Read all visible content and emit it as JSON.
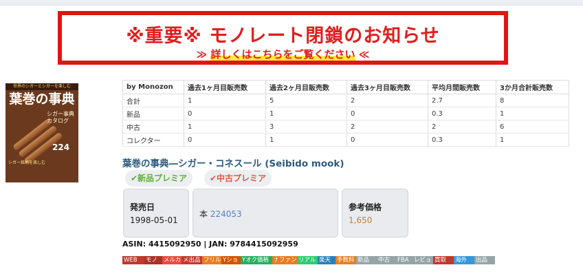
{
  "banner": {
    "title": "※重要※ モノレート閉鎖のお知らせ",
    "link_prefix": "≫ ",
    "link_text": "詳しくはこちらをご覧ください",
    "link_suffix": " ≪"
  },
  "cover": {
    "top_text": "世界のシガーとシガーを楽しむ",
    "title": "葉巻の事典",
    "sub_text": "シガー事典カタログ",
    "number": "224",
    "bottom_text": "シガー銘柄を楽しむ"
  },
  "sales_table": {
    "headers": [
      "by Monozon",
      "過去1ヶ月目販売数",
      "過去2ヶ月目販売数",
      "過去3ヶ月目販売数",
      "平均月間販売数",
      "3か月合計販売数"
    ],
    "rows": [
      [
        "合計",
        "1",
        "5",
        "2",
        "2.7",
        "8"
      ],
      [
        "新品",
        "0",
        "1",
        "0",
        "0.3",
        "1"
      ],
      [
        "中古",
        "1",
        "3",
        "2",
        "2",
        "6"
      ],
      [
        "コレクター",
        "0",
        "1",
        "0",
        "0.3",
        "1"
      ]
    ]
  },
  "product": {
    "title": "葉巻の事典―シガー・コネスール (Seibido mook)",
    "premium_new": "✔新品プレミア",
    "premium_used": "✔中古プレミア",
    "release_label": "発売日",
    "release_value": "1998-05-01",
    "book_label": "本",
    "book_rank": "224053",
    "price_label": "参考価格",
    "price_value": "1,650",
    "codes": "ASIN: 4415092950 | JAN: 9784415092959"
  },
  "tags": [
    {
      "label": "WEB",
      "color": "#c0392b"
    },
    {
      "label": "モノ",
      "color": "#a93226"
    },
    {
      "label": "メルカ",
      "color": "#e74c3c"
    },
    {
      "label": "メ出品",
      "color": "#c0392b"
    },
    {
      "label": "フリル",
      "color": "#e67e22"
    },
    {
      "label": "Yショ",
      "color": "#d35400"
    },
    {
      "label": "Yオク価格",
      "color": "#27ae60"
    },
    {
      "label": "ナ",
      "color": "#e67e22"
    },
    {
      "label": "ファン",
      "color": "#e67e22"
    },
    {
      "label": "リアル",
      "color": "#2ecc71"
    },
    {
      "label": "楽天",
      "color": "#2980b9"
    },
    {
      "label": "手数料",
      "color": "#e67e22"
    },
    {
      "label": "新品",
      "color": "#95a5a6"
    },
    {
      "label": "中古",
      "color": "#95a5a6"
    },
    {
      "label": "FBA",
      "color": "#95a5a6"
    },
    {
      "label": "レビュ",
      "color": "#95a5a6"
    },
    {
      "label": "買取",
      "color": "#c0392b"
    },
    {
      "label": "海外",
      "color": "#3498db"
    },
    {
      "label": "出品",
      "color": "#95a5a6"
    }
  ]
}
